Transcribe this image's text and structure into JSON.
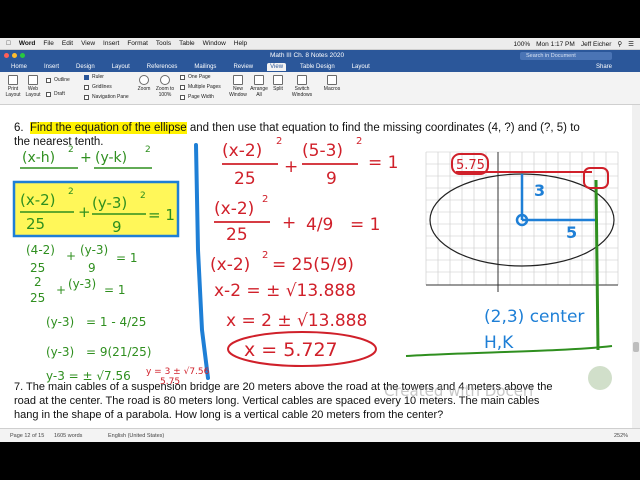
{
  "app": {
    "menubar": [
      "Word",
      "File",
      "Edit",
      "View",
      "Insert",
      "Format",
      "Tools",
      "Table",
      "Window",
      "Help"
    ],
    "battery": "100%",
    "clock": "Mon 1:17 PM",
    "user": "Jeff Eicher",
    "doc_title": "Math III Ch. 8 Notes 2020",
    "search_placeholder": "Search in Document",
    "tabs": [
      "Home",
      "Insert",
      "Design",
      "Layout",
      "References",
      "Mailings",
      "Review",
      "View",
      "Table Design",
      "Layout"
    ],
    "active_tab": "View",
    "share_label": "Share"
  },
  "ribbon": {
    "print_layout": "Print Layout",
    "web_layout": "Web Layout",
    "outline": "Outline",
    "draft": "Draft",
    "ruler": "Ruler",
    "gridlines": "Gridlines",
    "navigation_pane": "Navigation Pane",
    "one_page": "One Page",
    "multiple_pages": "Multiple Pages",
    "page_width": "Page Width",
    "zoom": "Zoom",
    "zoom_100": "Zoom to 100%",
    "new_window": "New Window",
    "arrange_all": "Arrange All",
    "split": "Split",
    "switch_windows": "Switch Windows",
    "macros": "Macros"
  },
  "document": {
    "problem6_num": "6.",
    "problem6_highlight": "Find the equation of the ellipse",
    "problem6_rest": " and then use that equation to find the missing coordinates (4, ?) and (?, 5) to",
    "problem6_line2": "the nearest tenth.",
    "problem7_line1": "7.  The main cables of a suspension bridge are 20 meters above the road at the towers and 4 meters above the",
    "problem7_line2": "road at the center.  The road is 80 meters long.  Vertical cables are spaced every 10 meters.  The main cables",
    "problem7_line3": "hang in the shape of a parabola.  How long is a vertical cable 20 meters from the center?"
  },
  "handwriting": {
    "general_form_num1": "(x-h)",
    "general_form_num2": "(y-k)",
    "exp": "2",
    "boxed_a": "(x-2)",
    "boxed_b": "(y-3)",
    "den_25": "25",
    "den_9": "9",
    "eq_1": "= 1",
    "plus": "+",
    "green_l1a": "(4-2)",
    "green_l1b": "(y-3)",
    "green_l2a": "2",
    "green_l2b": "(y-3)",
    "green_l3": "(y-3)",
    "green_l3r": "= 1 - 4/25",
    "green_l4": "(y-3)",
    "green_l4r": "= 9(21/25)",
    "green_l5": "y-3 = ± √7.56",
    "red_sol": "y = 3 ± √7.56",
    "red_val": "5.75",
    "red_l1a": "(x-2)",
    "red_l1b": "(5-3)",
    "red_l2a": "(x-2)",
    "red_l2b": "4/9",
    "red_l3": "(x-2)",
    "red_l3r": "= 25(5/9)",
    "red_l4": "x-2 = ± √13.888",
    "red_l5": "x = 2 ± √13.888",
    "red_l6": "x = 5.727",
    "graph_label_575": "5.75",
    "graph_label_3": "3",
    "graph_label_5": "5",
    "center": "(2,3) center",
    "hk": "H,K"
  },
  "status": {
    "page": "Page 12 of 15",
    "words": "1605 words",
    "language": "English (United States)",
    "zoom": "252%"
  },
  "watermark": "Created with Doceri",
  "colors": {
    "word_blue": "#2b579a",
    "ink_red": "#d0202a",
    "ink_green": "#2f8f1f",
    "ink_blue": "#1e7fd6",
    "highlight": "#fff200"
  }
}
